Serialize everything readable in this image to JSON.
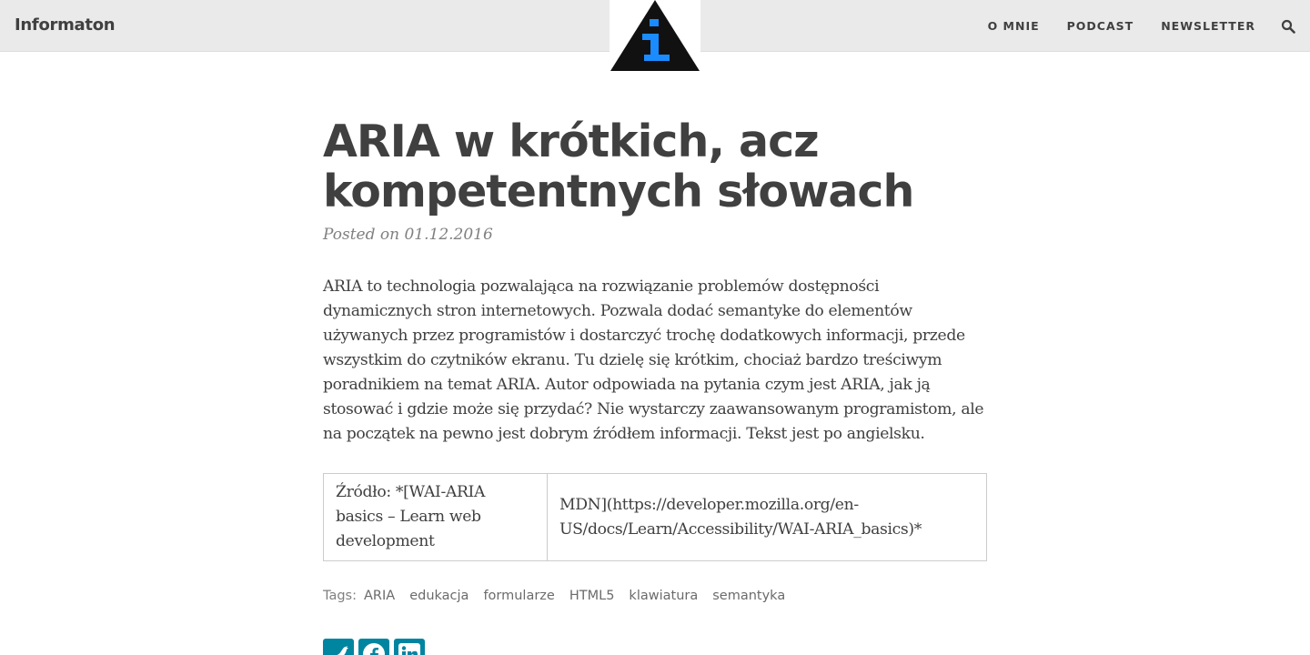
{
  "brand": "Informaton",
  "logo": {
    "icon": "info-triangle-icon",
    "triangle_color": "#111111",
    "glyph_color": "#1a8cff"
  },
  "nav": {
    "items": [
      "O MNIE",
      "PODCAST",
      "NEWSLETTER"
    ],
    "search_icon": "search-icon"
  },
  "post": {
    "title": "ARIA w krótkich, acz kompetentnych słowach",
    "meta": "Posted on 01.12.2016",
    "body": "ARIA to technologia pozwalająca na rozwiązanie problemów dostępności dynamicznych stron internetowych. Pozwala dodać semantyke do elementów używanych przez programistów i dostarczyć trochę dodatkowych informacji, przede wszystkim do czytników ekranu. Tu dzielę się krótkim, chociaż bardzo treściwym poradnikiem na temat ARIA. Autor odpowiada na pytania czym jest ARIA, jak ją stosować i gdzie może się przydać? Nie wystarczy zaawansowanym programistom, ale na początek na pewno jest dobrym źródłem informacji. Tekst jest po angielsku.",
    "table": {
      "cell_1": "Źródło: *[WAI-ARIA basics – Learn web development",
      "cell_2": "MDN](https://developer.mozilla.org/en-US/docs/Learn/Accessibility/WAI-ARIA_basics)*"
    },
    "tags_label": "Tags:",
    "tags": [
      "ARIA",
      "edukacja",
      "formularze",
      "HTML5",
      "klawiatura",
      "semantyka"
    ]
  },
  "share": {
    "buttons": [
      "twitter-icon",
      "facebook-icon",
      "linkedin-icon"
    ],
    "color": "#0085a1"
  }
}
